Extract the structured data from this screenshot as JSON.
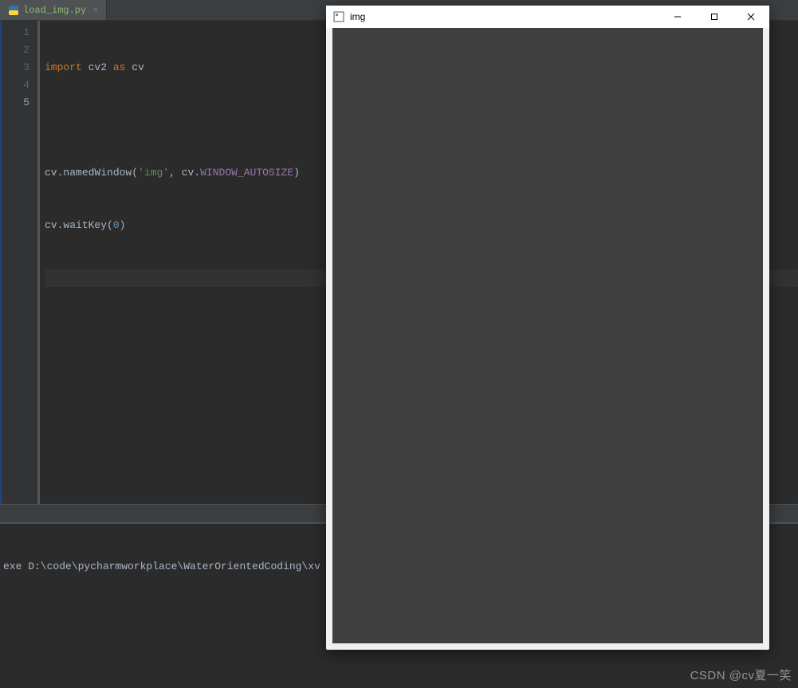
{
  "tab": {
    "filename": "load_img.py",
    "close_glyph": "×"
  },
  "gutter": {
    "lines": [
      "1",
      "2",
      "3",
      "4",
      "5"
    ],
    "current_index": 4
  },
  "code": {
    "l1": {
      "kw_import": "import",
      "mod": "cv2",
      "kw_as": "as",
      "alias": "cv"
    },
    "l3": {
      "obj": "cv",
      "dot": ".",
      "fn": "namedWindow",
      "lp": "(",
      "str": "'img'",
      "comma": ", ",
      "obj2": "cv",
      "dot2": ".",
      "mem": "WINDOW_AUTOSIZE",
      "rp": ")"
    },
    "l4": {
      "obj": "cv",
      "dot": ".",
      "fn": "waitKey",
      "lp": "(",
      "num": "0",
      "rp": ")"
    }
  },
  "terminal": {
    "line1": "exe D:\\code\\pycharmworkplace\\WaterOrientedCoding\\xv"
  },
  "window": {
    "title": "img",
    "minimize_glyph": "—",
    "maximize_glyph": "☐",
    "close_glyph": "✕"
  },
  "watermark": "CSDN @cv夏一笑"
}
